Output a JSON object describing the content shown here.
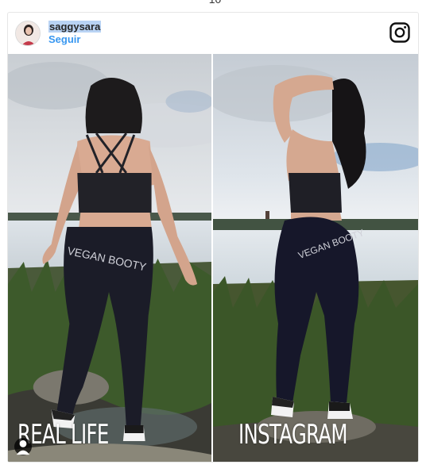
{
  "page": {
    "top_fragment": "10"
  },
  "post": {
    "username": "saggysara",
    "follow_label": "Seguir",
    "left_caption": "REAL LIFE",
    "right_caption": "INSTAGRAM",
    "leggings_text": "VEGAN BOOTY"
  },
  "icons": {
    "brand": "instagram-icon",
    "tag": "user-tag-icon"
  },
  "colors": {
    "link_blue": "#3897f0",
    "username_highlight": "#b9d3f4",
    "text_dark": "#262626",
    "border": "#e6e6e6"
  }
}
